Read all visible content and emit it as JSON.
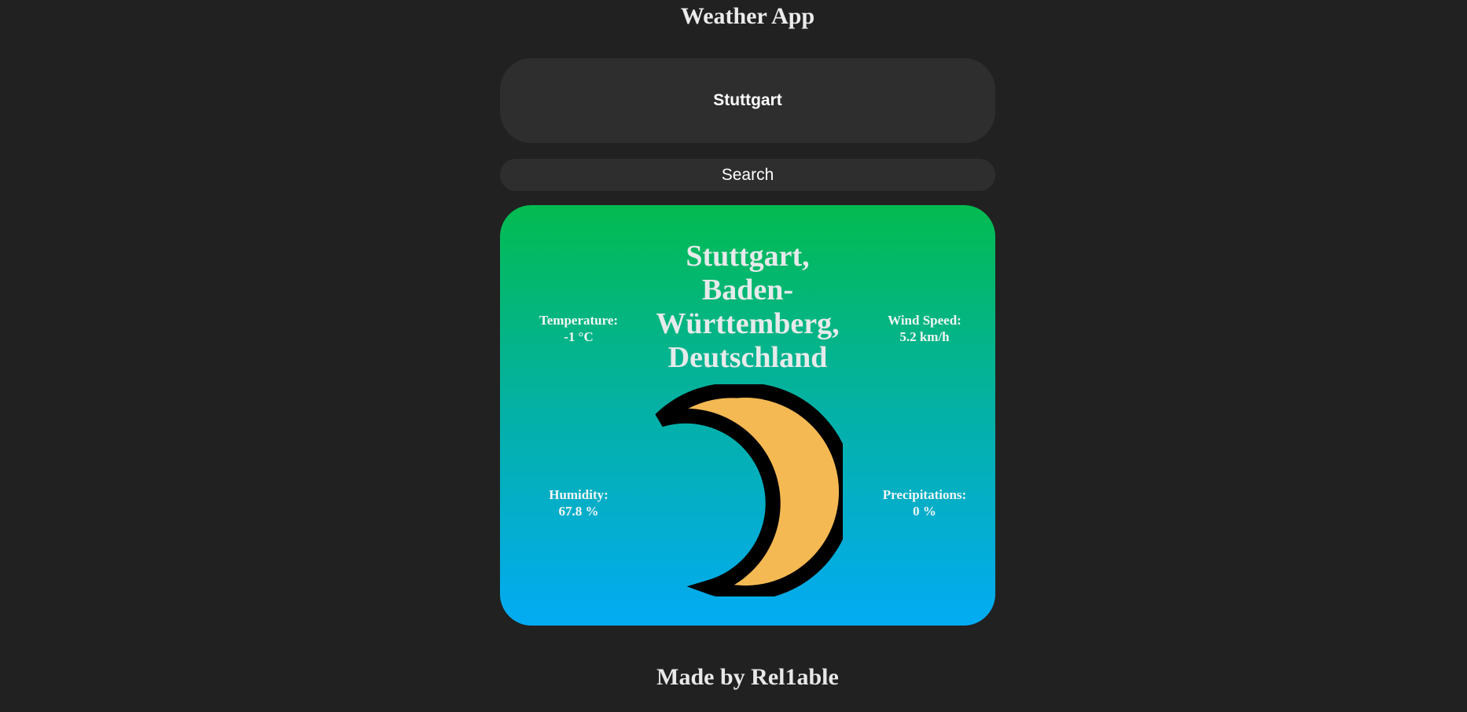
{
  "header": {
    "title": "Weather App"
  },
  "search": {
    "value": "Stuttgart",
    "button_label": "Search"
  },
  "weather": {
    "location_lines": [
      "Stuttgart,",
      "Baden-",
      "Württemberg,",
      "Deutschland"
    ],
    "temperature": {
      "label": "Temperature:",
      "value": "-1 °C"
    },
    "wind_speed": {
      "label": "Wind Speed:",
      "value": "5.2 km/h"
    },
    "humidity": {
      "label": "Humidity:",
      "value": "67.8 %"
    },
    "precipitation": {
      "label": "Precipitations:",
      "value": "0 %"
    },
    "condition_icon": "crescent-moon-icon"
  },
  "footer": {
    "credit": "Made by Rel1able"
  },
  "colors": {
    "background": "#212121",
    "control_background": "#2e2e2e",
    "card_gradient_top": "#03bb50",
    "card_gradient_bottom": "#03abf3",
    "moon_fill": "#f4b953",
    "moon_outline": "#000000"
  }
}
